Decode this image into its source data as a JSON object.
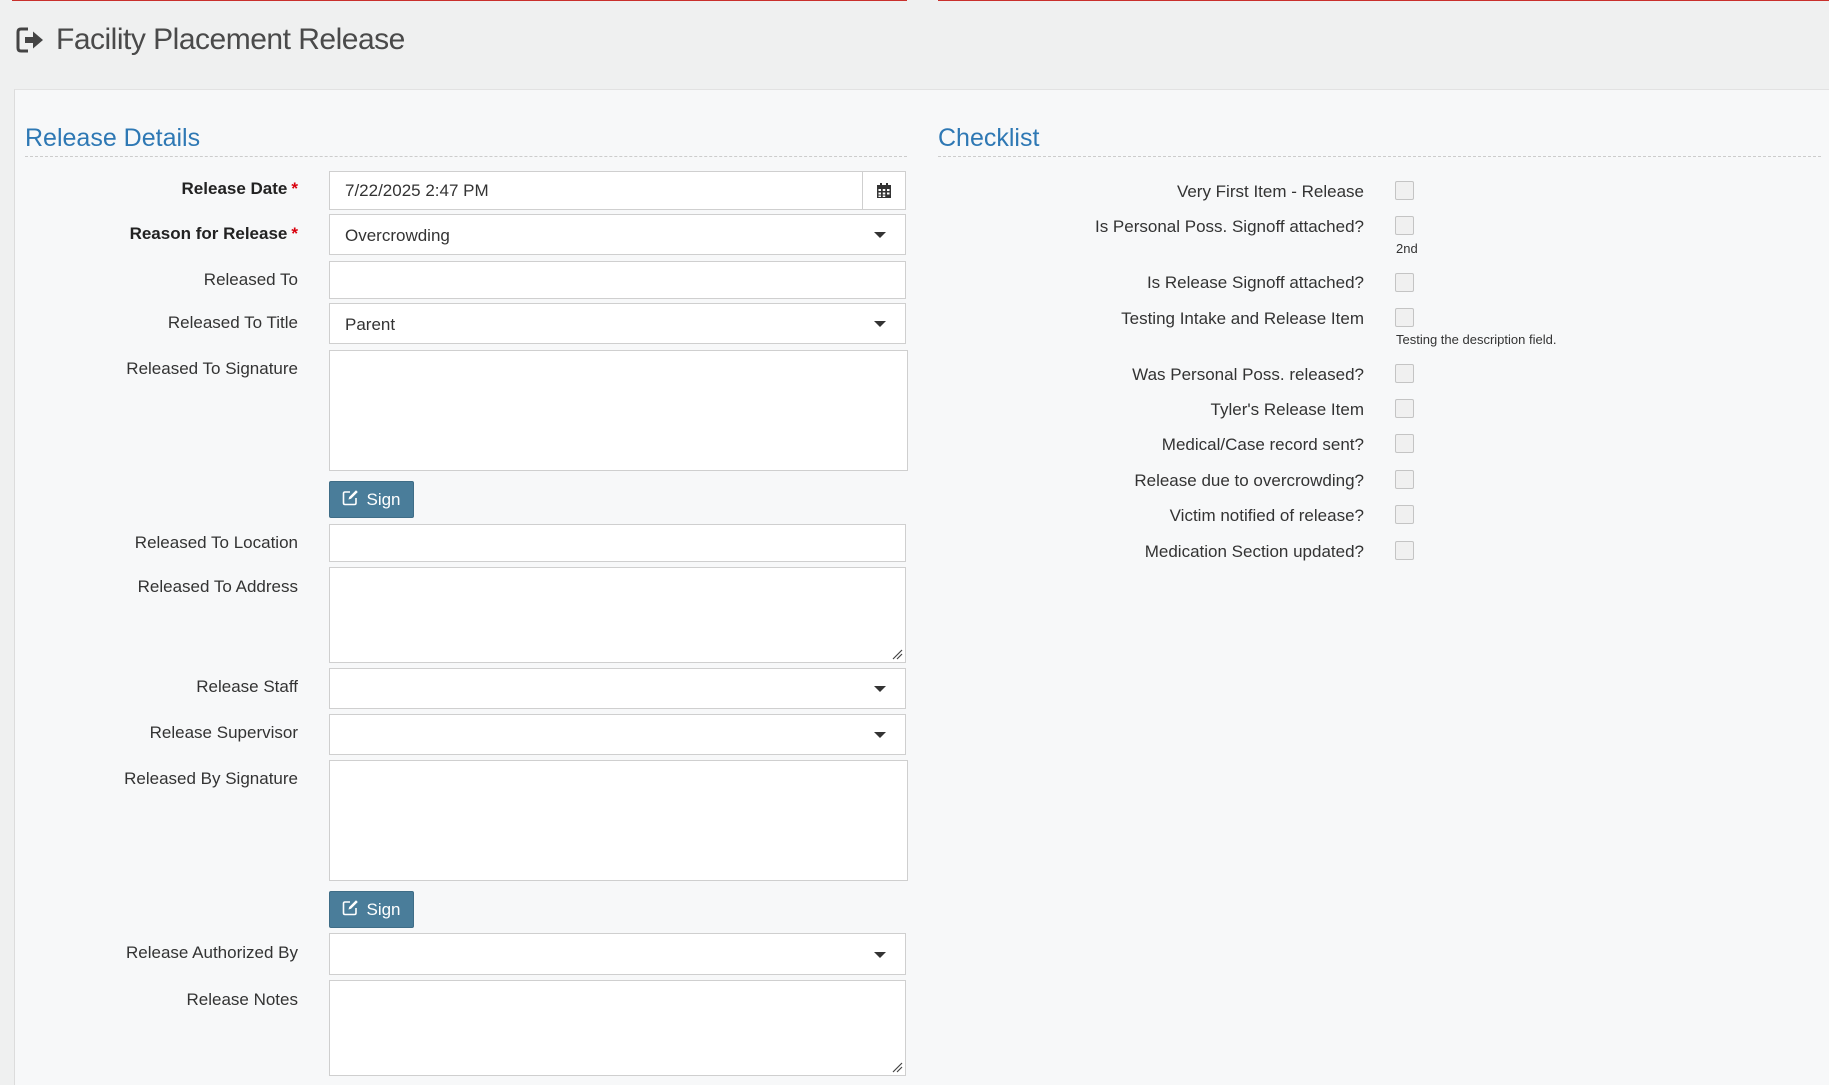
{
  "page": {
    "title": "Facility Placement Release",
    "icon": "sign-out-icon"
  },
  "release_details": {
    "title": "Release Details",
    "release_date": {
      "label": "Release Date",
      "required": "*",
      "value": "7/22/2025 2:47 PM"
    },
    "reason_for_release": {
      "label": "Reason for Release",
      "required": "*",
      "value": "Overcrowding"
    },
    "released_to": {
      "label": "Released To",
      "value": ""
    },
    "released_to_title": {
      "label": "Released To Title",
      "value": "Parent"
    },
    "released_to_signature": {
      "label": "Released To Signature"
    },
    "sign_label_1": "Sign",
    "released_to_location": {
      "label": "Released To Location",
      "value": ""
    },
    "released_to_address": {
      "label": "Released To Address",
      "value": ""
    },
    "release_staff": {
      "label": "Release Staff",
      "value": ""
    },
    "release_supervisor": {
      "label": "Release Supervisor",
      "value": ""
    },
    "released_by_signature": {
      "label": "Released By Signature"
    },
    "sign_label_2": "Sign",
    "release_authorized_by": {
      "label": "Release Authorized By",
      "value": ""
    },
    "release_notes": {
      "label": "Release Notes",
      "value": ""
    }
  },
  "checklist": {
    "title": "Checklist",
    "items": [
      {
        "label": "Very First Item - Release",
        "checked": false,
        "description": ""
      },
      {
        "label": "Is Personal Poss. Signoff attached?",
        "checked": false,
        "description": "2nd"
      },
      {
        "label": "Is Release Signoff attached?",
        "checked": false,
        "description": ""
      },
      {
        "label": "Testing Intake and Release Item",
        "checked": false,
        "description": "Testing the description field."
      },
      {
        "label": "Was Personal Poss. released?",
        "checked": false,
        "description": ""
      },
      {
        "label": "Tyler's Release Item",
        "checked": false,
        "description": ""
      },
      {
        "label": "Medical/Case record sent?",
        "checked": false,
        "description": ""
      },
      {
        "label": "Release due to overcrowding?",
        "checked": false,
        "description": ""
      },
      {
        "label": "Victim notified of release?",
        "checked": false,
        "description": ""
      },
      {
        "label": "Medication Section updated?",
        "checked": false,
        "description": ""
      }
    ]
  },
  "colors": {
    "accent": "#2e78b4",
    "button": "#4a7d9a",
    "required": "#d9000d",
    "top_line": "#c9302c"
  }
}
